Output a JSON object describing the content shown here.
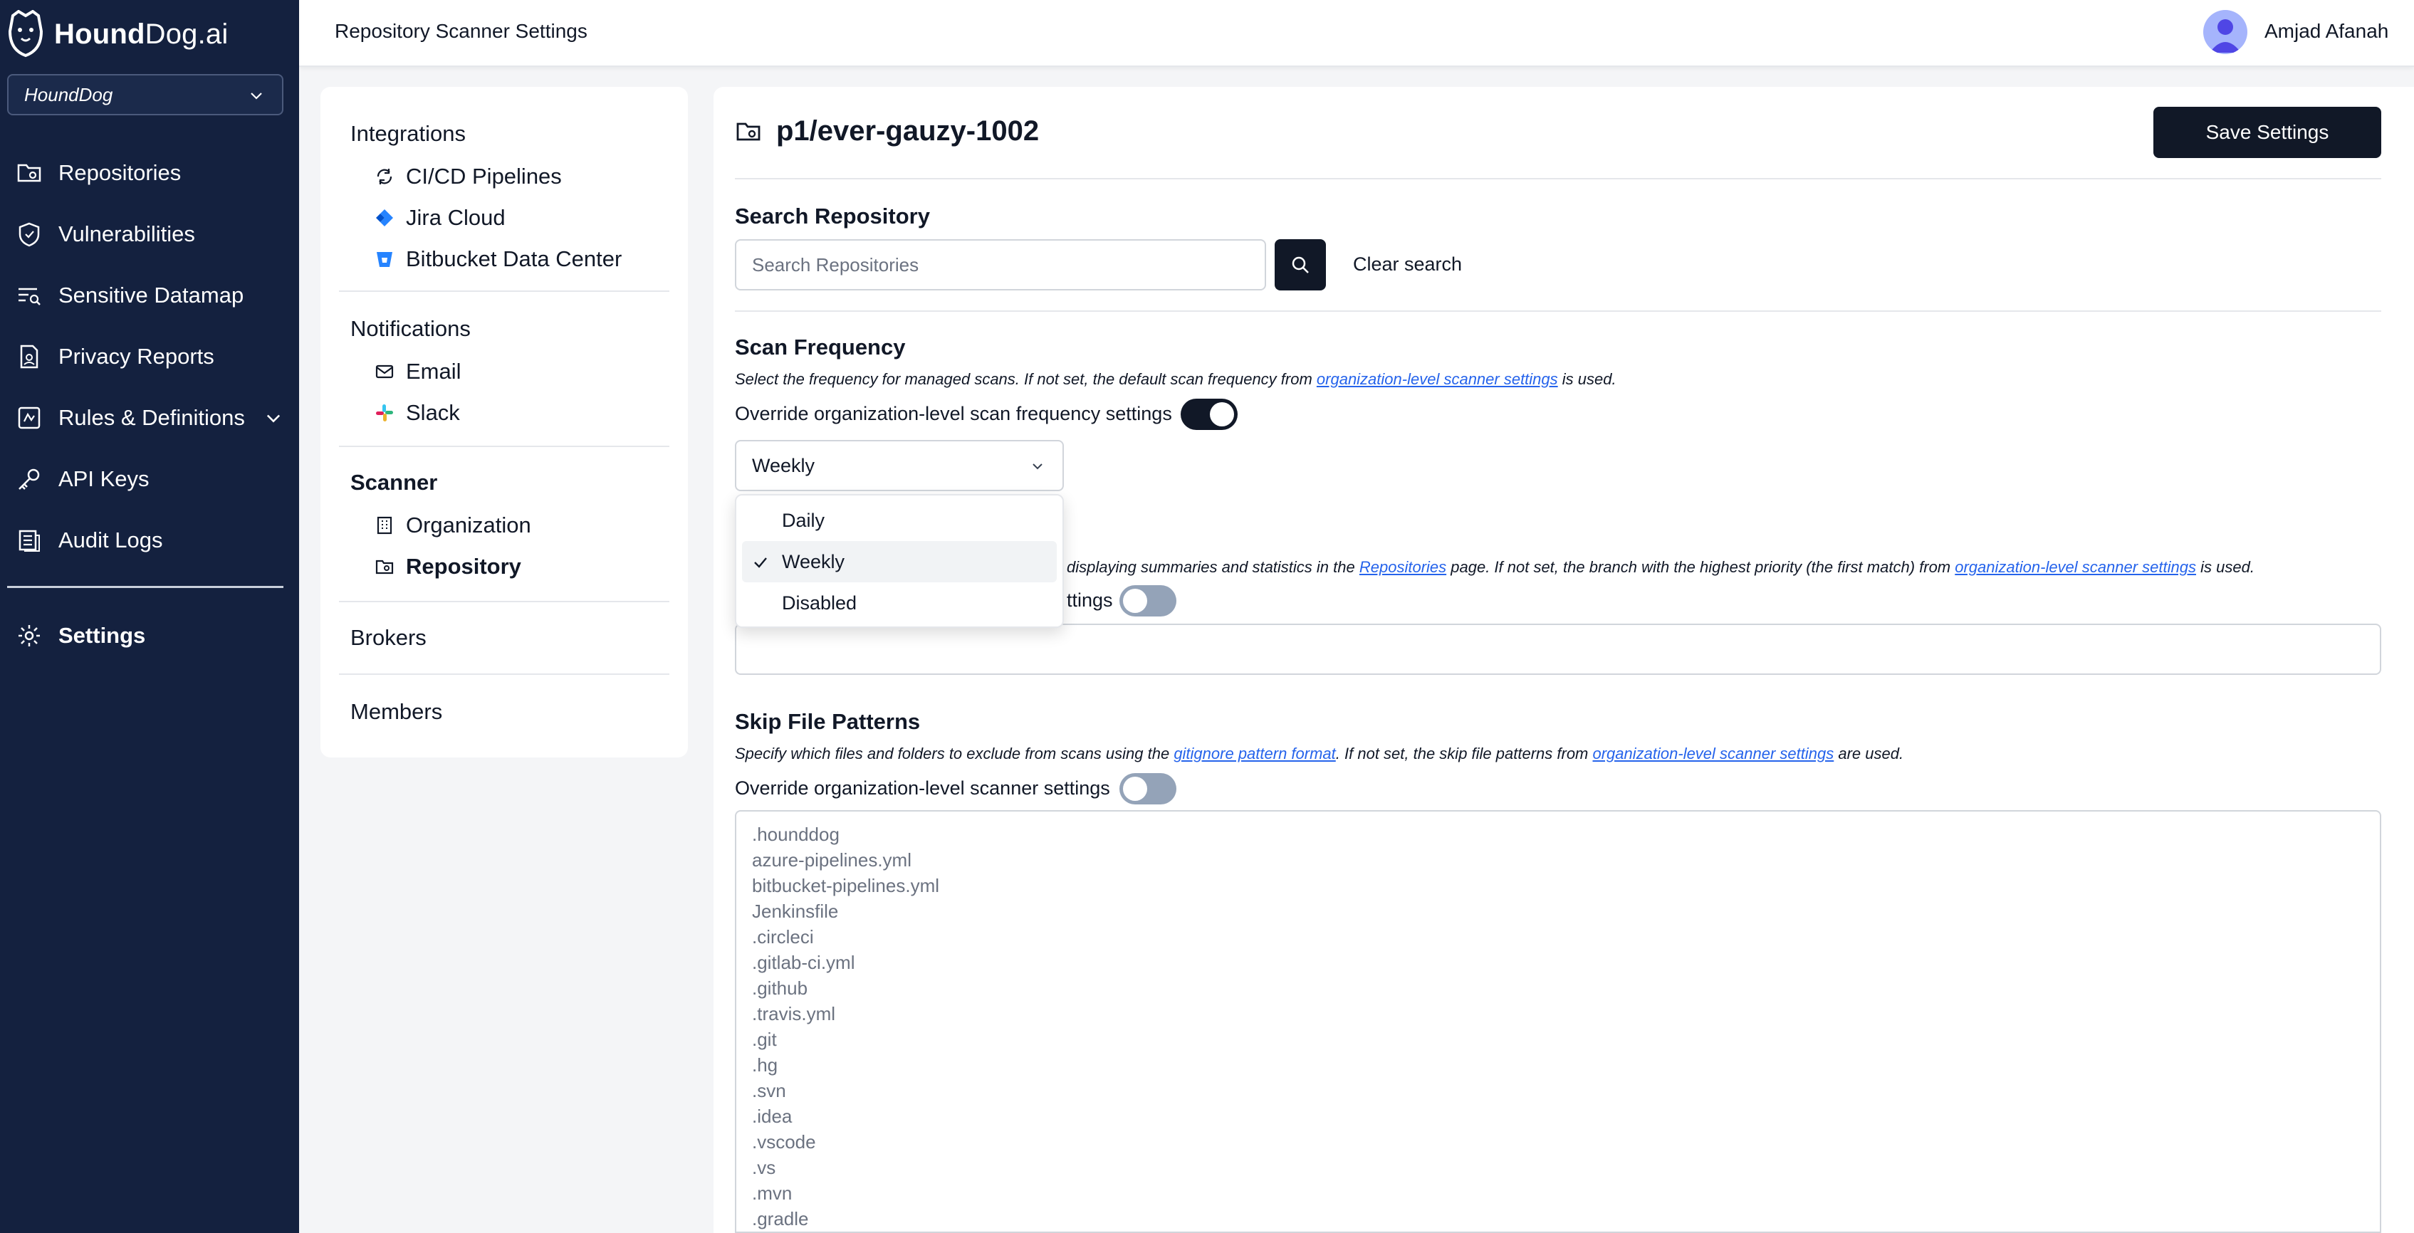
{
  "app": {
    "brand_bold": "Hound",
    "brand_rest": "Dog.ai",
    "org_selector": "HoundDog"
  },
  "sidebar": {
    "items": [
      {
        "label": "Repositories",
        "icon": "repo-folder-icon"
      },
      {
        "label": "Vulnerabilities",
        "icon": "shield-icon"
      },
      {
        "label": "Sensitive Datamap",
        "icon": "datamap-icon"
      },
      {
        "label": "Privacy Reports",
        "icon": "report-icon"
      },
      {
        "label": "Rules & Definitions",
        "icon": "rules-icon"
      },
      {
        "label": "API Keys",
        "icon": "key-icon"
      },
      {
        "label": "Audit Logs",
        "icon": "audit-log-icon"
      }
    ],
    "settings_label": "Settings"
  },
  "header": {
    "title": "Repository Scanner Settings",
    "user_name": "Amjad Afanah"
  },
  "settings_nav": {
    "integrations": {
      "heading": "Integrations",
      "items": [
        "CI/CD Pipelines",
        "Jira Cloud",
        "Bitbucket Data Center"
      ]
    },
    "notifications": {
      "heading": "Notifications",
      "items": [
        "Email",
        "Slack"
      ]
    },
    "scanner": {
      "heading": "Scanner",
      "items": [
        "Organization",
        "Repository"
      ]
    },
    "brokers": "Brokers",
    "members": "Members"
  },
  "main": {
    "repo_name": "p1/ever-gauzy-1002",
    "save_label": "Save Settings",
    "search": {
      "heading": "Search Repository",
      "placeholder": "Search Repositories",
      "clear_label": "Clear search"
    },
    "scan_frequency": {
      "heading": "Scan Frequency",
      "desc_pre": "Select the frequency for managed scans. If not set, the default scan frequency from ",
      "desc_link": "organization-level scanner settings",
      "desc_post": " is used.",
      "override_label": "Override organization-level scan frequency settings",
      "override_on": true,
      "selected": "Weekly",
      "options": [
        "Daily",
        "Weekly",
        "Disabled"
      ]
    },
    "default_branch": {
      "desc_partial_pre": "displaying summaries and statistics in the ",
      "desc_link1": "Repositories",
      "desc_mid": " page. If not set, the branch with the highest priority (the first match) from ",
      "desc_link2": "organization-level scanner settings",
      "desc_post": " is used.",
      "override_partial": "ttings",
      "override_on": false
    },
    "skip_patterns": {
      "heading": "Skip File Patterns",
      "desc_pre": "Specify which files and folders to exclude from scans using the ",
      "desc_link1": "gitignore pattern format",
      "desc_mid": ". If not set, the skip file patterns from ",
      "desc_link2": "organization-level scanner settings",
      "desc_post": " are used.",
      "override_label": "Override organization-level scanner settings",
      "override_on": false,
      "patterns": [
        ".hounddog",
        "azure-pipelines.yml",
        "bitbucket-pipelines.yml",
        "Jenkinsfile",
        ".circleci",
        ".gitlab-ci.yml",
        ".github",
        ".travis.yml",
        ".git",
        ".hg",
        ".svn",
        ".idea",
        ".vscode",
        ".vs",
        ".mvn",
        ".gradle"
      ]
    }
  },
  "colors": {
    "sidebar_bg": "#14213f",
    "primary": "#111827",
    "link": "#2563eb",
    "toggle_off": "#94a3b8"
  }
}
